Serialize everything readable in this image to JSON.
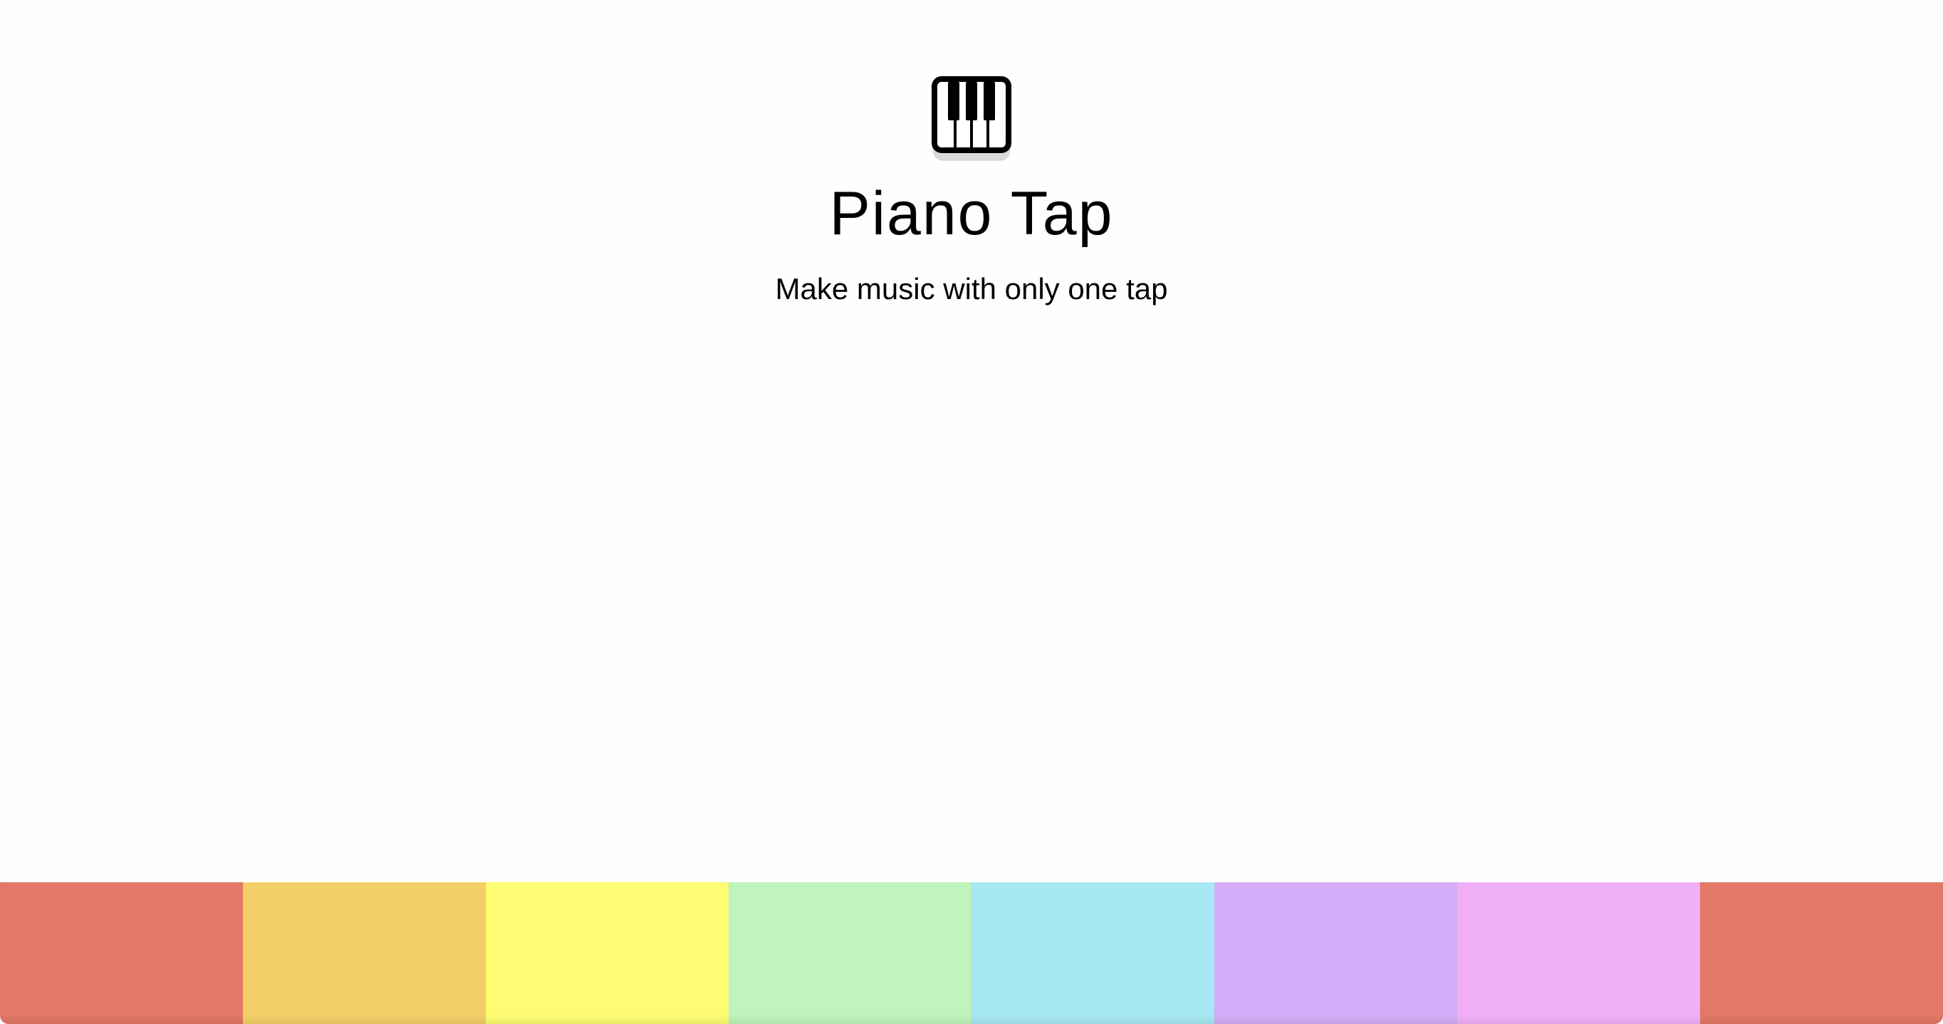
{
  "app": {
    "icon": "piano-keys-icon",
    "title": "Piano Tap",
    "subtitle": "Make music with only one tap"
  },
  "keys": [
    {
      "color": "#e27867"
    },
    {
      "color": "#f4cf67"
    },
    {
      "color": "#fdfc72"
    },
    {
      "color": "#c1f3bd"
    },
    {
      "color": "#a7e8f2"
    },
    {
      "color": "#d4adf8"
    },
    {
      "color": "#f1aff6"
    },
    {
      "color": "#e27867"
    }
  ]
}
